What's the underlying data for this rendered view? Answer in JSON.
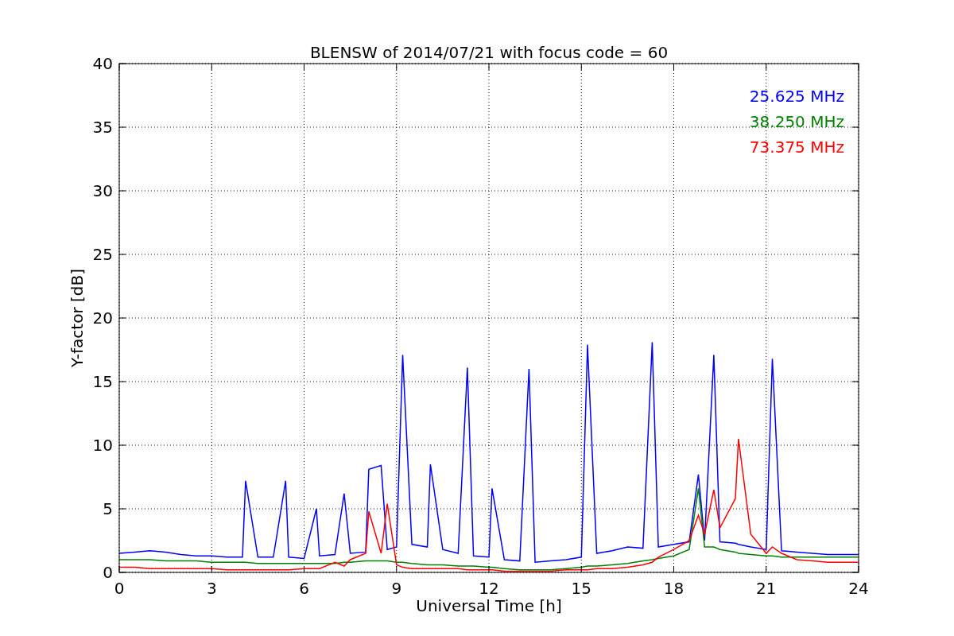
{
  "figure": {
    "chart_data": {
      "type": "line",
      "title": "BLENSW of 2014/07/21 with focus code = 60",
      "xlabel": "Universal Time [h]",
      "ylabel": "Y-factor [dB]",
      "xlim": [
        0,
        24
      ],
      "ylim": [
        0,
        40
      ],
      "grid": true,
      "xticks": [
        0,
        3,
        6,
        9,
        12,
        15,
        18,
        21,
        24
      ],
      "yticks": [
        0,
        5,
        10,
        15,
        20,
        25,
        30,
        35,
        40
      ],
      "x": [
        0,
        0.5,
        1,
        1.5,
        2,
        2.5,
        3,
        3.5,
        4,
        4.1,
        4.5,
        5,
        5.4,
        5.5,
        6,
        6.4,
        6.5,
        7,
        7.3,
        7.5,
        8,
        8.1,
        8.5,
        8.7,
        9,
        9.2,
        9.5,
        10,
        10.1,
        10.5,
        11,
        11.3,
        11.5,
        12,
        12.1,
        12.5,
        13,
        13.3,
        13.5,
        14,
        14.5,
        15,
        15.2,
        15.5,
        16,
        16.5,
        17,
        17.3,
        17.5,
        18,
        18.5,
        18.8,
        19,
        19.3,
        19.5,
        20,
        20.1,
        20.5,
        21,
        21.2,
        21.5,
        22,
        22.5,
        23,
        23.5,
        24
      ],
      "series": [
        {
          "name": "25.625 MHz",
          "color": "#0000ff",
          "values": [
            1.5,
            1.6,
            1.7,
            1.6,
            1.4,
            1.3,
            1.3,
            1.2,
            1.2,
            7.2,
            1.2,
            1.2,
            7.2,
            1.2,
            1.1,
            5.0,
            1.3,
            1.4,
            6.2,
            1.5,
            1.6,
            8.1,
            8.4,
            1.8,
            2.0,
            17.1,
            2.2,
            2.0,
            8.5,
            1.8,
            1.5,
            16.1,
            1.3,
            1.2,
            6.6,
            1.0,
            0.9,
            16.0,
            0.8,
            0.9,
            1.0,
            1.2,
            17.9,
            1.5,
            1.7,
            2.0,
            1.9,
            18.1,
            2.0,
            2.2,
            2.4,
            7.7,
            2.5,
            17.1,
            2.4,
            2.3,
            2.2,
            2.0,
            1.8,
            16.8,
            1.7,
            1.6,
            1.5,
            1.4,
            1.4,
            1.4
          ]
        },
        {
          "name": "38.250 MHz",
          "color": "#008000",
          "values": [
            1.0,
            1.0,
            1.0,
            0.9,
            0.9,
            0.9,
            0.8,
            0.8,
            0.8,
            0.8,
            0.7,
            0.7,
            0.7,
            0.7,
            0.7,
            0.7,
            0.7,
            0.7,
            0.8,
            0.8,
            0.9,
            0.9,
            0.9,
            0.9,
            0.8,
            0.8,
            0.7,
            0.6,
            0.6,
            0.6,
            0.5,
            0.5,
            0.5,
            0.4,
            0.4,
            0.3,
            0.2,
            0.2,
            0.2,
            0.2,
            0.3,
            0.4,
            0.5,
            0.5,
            0.6,
            0.7,
            0.9,
            1.0,
            1.1,
            1.3,
            1.8,
            6.6,
            2.0,
            2.0,
            1.8,
            1.6,
            1.5,
            1.4,
            1.3,
            1.3,
            1.2,
            1.2,
            1.2,
            1.2,
            1.2,
            1.2
          ]
        },
        {
          "name": "73.375 MHz",
          "color": "#ff0000",
          "values": [
            0.4,
            0.4,
            0.3,
            0.3,
            0.3,
            0.3,
            0.3,
            0.2,
            0.2,
            0.2,
            0.2,
            0.2,
            0.2,
            0.2,
            0.3,
            0.3,
            0.3,
            0.8,
            0.5,
            1.0,
            1.5,
            4.8,
            1.5,
            5.4,
            0.6,
            0.4,
            0.3,
            0.3,
            0.3,
            0.3,
            0.3,
            0.2,
            0.2,
            0.2,
            0.2,
            0.1,
            0.1,
            0.1,
            0.1,
            0.1,
            0.2,
            0.2,
            0.2,
            0.3,
            0.3,
            0.4,
            0.6,
            0.8,
            1.2,
            1.8,
            2.5,
            4.5,
            3.0,
            6.5,
            3.5,
            5.8,
            10.5,
            3.0,
            1.5,
            2.0,
            1.5,
            1.0,
            0.9,
            0.8,
            0.8,
            0.8
          ]
        }
      ]
    }
  }
}
